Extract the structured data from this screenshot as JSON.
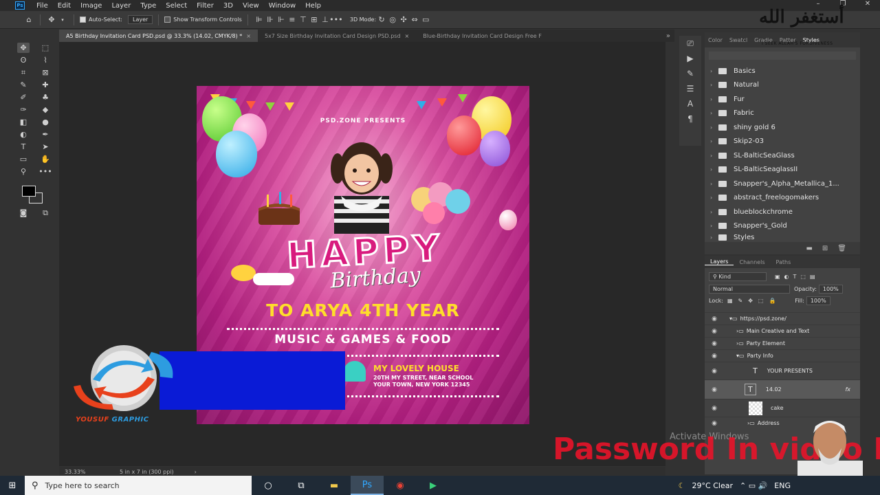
{
  "app": {
    "logo": "Ps"
  },
  "menu": [
    "File",
    "Edit",
    "Image",
    "Layer",
    "Type",
    "Select",
    "Filter",
    "3D",
    "View",
    "Window",
    "Help"
  ],
  "options_bar": {
    "auto_select_label": "Auto-Select:",
    "auto_select_value": "Layer",
    "show_transform_label": "Show Transform Controls",
    "mode_3d_label": "3D Mode:"
  },
  "tabs": [
    {
      "label": "A5 Birthday Invitation Card PSD.psd @ 33.3% (14.02, CMYK/8) *",
      "active": true
    },
    {
      "label": "5x7 Size Birthday Invitation Card Design PSD.psd",
      "active": false
    },
    {
      "label": "Blue-Birthday Invitation Card Design Free F",
      "active": false
    }
  ],
  "flyer": {
    "presents": "PSD.ZONE PRESENTS",
    "happy": "HAPPY",
    "birthday": "Birthday",
    "to_arya": "TO ARYA 4TH YEAR",
    "music": "MUSIC & GAMES & FOOD",
    "house": "MY LOVELY HOUSE",
    "addr1": "20TH MY STREET, NEAR SCHOOL",
    "addr2": "YOUR TOWN, NEW YORK 12345"
  },
  "logo_overlay": {
    "text_a": "YOUSUF",
    "text_b": "GRAPHIC",
    "accent_red": "#e8411c",
    "accent_blue": "#2d9ce0",
    "block_blue": "#0a1bd6"
  },
  "status": {
    "zoom": "33.33%",
    "doc_size": "5 in x 7 in (300 ppi)"
  },
  "styles_panel": {
    "tabs": [
      "Color",
      "Swatcl",
      "Gradie",
      "Patter",
      "Styles"
    ],
    "items": [
      "Basics",
      "Natural",
      "Fur",
      "Fabric",
      "shiny gold 6",
      "Skip2-03",
      "SL-BalticSeaGlass",
      "SL-BalticSeaglassII",
      "Snapper's_Alpha_Metallica_1...",
      "abstract_freelogomakers",
      "blueblockchrome",
      "Snapper's_Gold",
      "Styles"
    ]
  },
  "layers_panel": {
    "tabs": [
      "Layers",
      "Channels",
      "Paths"
    ],
    "kind": "Kind",
    "blend": "Normal",
    "opacity_label": "Opacity:",
    "opacity": "100%",
    "lock_label": "Lock:",
    "fill_label": "Fill:",
    "fill": "100%",
    "layers": [
      {
        "name": "https://psd.zone/"
      },
      {
        "name": "Main Creative and Text"
      },
      {
        "name": "Party Element"
      },
      {
        "name": "Party Info"
      },
      {
        "name": "YOUR PRESENTS"
      },
      {
        "name": "14.02",
        "fx": "fx"
      },
      {
        "name": "cake"
      },
      {
        "name": "Address"
      }
    ]
  },
  "watermarks": {
    "arabic": "أستغفر الله",
    "arabic_sub": "I SEEK ALLAH'S FORGIVENESS",
    "password": "Password In video I",
    "activate": "Activate Windows"
  },
  "taskbar": {
    "search_placeholder": "Type here to search",
    "weather": "29°C  Clear",
    "lang": "ENG"
  }
}
